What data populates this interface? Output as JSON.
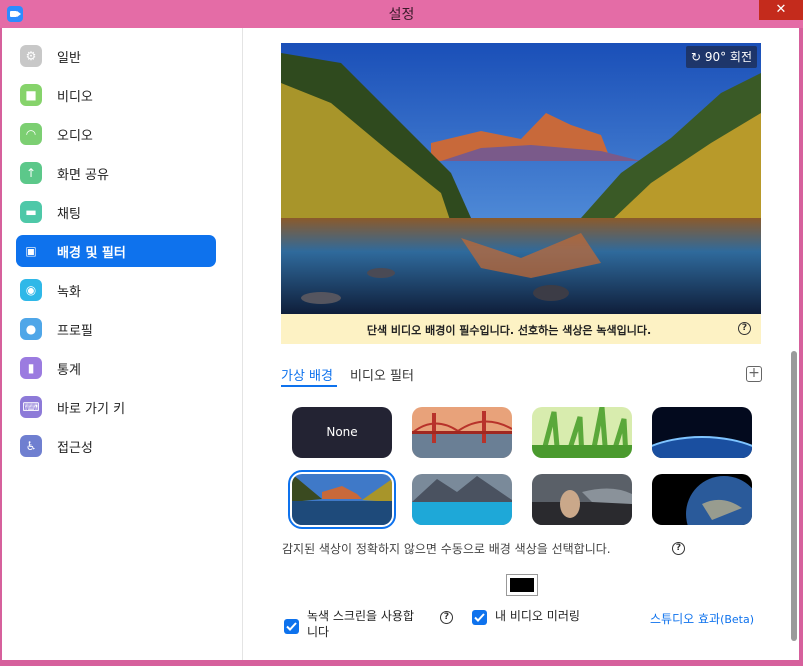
{
  "window": {
    "title": "설정",
    "close_symbol": "✕"
  },
  "sidebar": {
    "items": [
      {
        "label": "일반",
        "icon": "gear-icon",
        "color": "#c8c8c8",
        "glyph": "⚙",
        "active": false
      },
      {
        "label": "비디오",
        "icon": "video-camera-icon",
        "color": "#86d36b",
        "glyph": "■",
        "active": false
      },
      {
        "label": "오디오",
        "icon": "headphones-icon",
        "color": "#7ccf72",
        "glyph": "◠",
        "active": false
      },
      {
        "label": "화면 공유",
        "icon": "share-screen-icon",
        "color": "#5cc88a",
        "glyph": "↑",
        "active": false
      },
      {
        "label": "채팅",
        "icon": "chat-bubble-icon",
        "color": "#4ec8a8",
        "glyph": "▬",
        "active": false
      },
      {
        "label": "배경 및 필터",
        "icon": "background-filter-icon",
        "color": "#0e72ed",
        "glyph": "▣",
        "active": true
      },
      {
        "label": "녹화",
        "icon": "record-icon",
        "color": "#2fb8e8",
        "glyph": "◉",
        "active": false
      },
      {
        "label": "프로필",
        "icon": "profile-icon",
        "color": "#4fa6e8",
        "glyph": "●",
        "active": false
      },
      {
        "label": "통계",
        "icon": "statistics-icon",
        "color": "#9b7be0",
        "glyph": "▮",
        "active": false
      },
      {
        "label": "바로 가기 키",
        "icon": "keyboard-icon",
        "color": "#8d7ad8",
        "glyph": "⌨",
        "active": false
      },
      {
        "label": "접근성",
        "icon": "accessibility-icon",
        "color": "#6f7fd0",
        "glyph": "♿",
        "active": false
      }
    ]
  },
  "preview": {
    "rotate_label": "90° 회전"
  },
  "banner": {
    "text": "단색 비디오 배경이 필수입니다. 선호하는 색상은 녹색입니다.",
    "help": "?"
  },
  "tabs": [
    {
      "label": "가상 배경",
      "active": true
    },
    {
      "label": "비디오 필터",
      "active": false
    }
  ],
  "add_button": "+",
  "backgrounds": [
    {
      "label": "None",
      "kind": "none",
      "selected": false
    },
    {
      "name": "golden-gate-bridge",
      "selected": false
    },
    {
      "name": "grass",
      "selected": false
    },
    {
      "name": "earth-horizon",
      "selected": false
    },
    {
      "name": "mountain-lake",
      "selected": true
    },
    {
      "name": "glacier-lake",
      "selected": false
    },
    {
      "name": "beach-rock",
      "selected": false
    },
    {
      "name": "earth-space",
      "selected": false
    }
  ],
  "color_detect": {
    "text": "감지된 색상이 정확하지 않으면 수동으로 배경 색상을 선택합니다.",
    "help": "?",
    "swatch_color": "#000000"
  },
  "options": {
    "green_screen_label": "녹색 스크린을 사용합\n니다",
    "green_screen_help": "?",
    "mirror_label": "내 비디오 미러링",
    "studio_label": "스튜디오 효과",
    "studio_beta": "(Beta)"
  },
  "colors": {
    "accent": "#0e72ed",
    "title_bar": "#e46ca6",
    "close": "#c42b1c",
    "banner": "#fdf2c4"
  }
}
